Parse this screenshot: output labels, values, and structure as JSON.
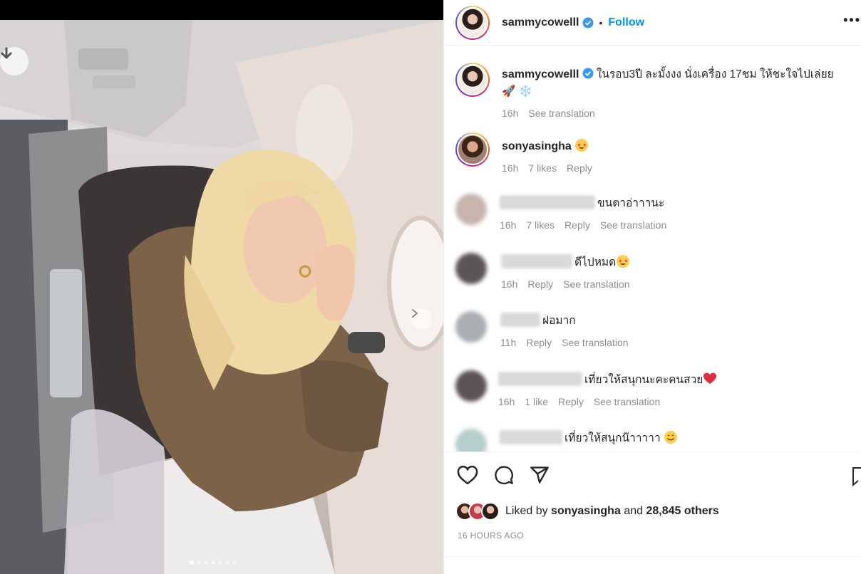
{
  "post": {
    "username": "sammycowelll",
    "follow_label": "Follow",
    "separator": "•",
    "more_label": "•••",
    "caption": "ในรอบ3ปี ละมั้งงง นั่งเครื่อง 17ชม ให้ชะใจไปเล่ยย",
    "caption_time": "16h",
    "see_translation": "See translation",
    "carousel": {
      "slide_count": 7,
      "active_index": 0
    }
  },
  "comments": [
    {
      "username": "sonyasingha",
      "text": "",
      "emoji": "star-struck-emoji",
      "time": "16h",
      "likes": "7 likes",
      "reply": "Reply",
      "translation": ""
    },
    {
      "username": "",
      "text": "ขนตาอ่าาานะ",
      "emoji": "",
      "time": "16h",
      "likes": "7 likes",
      "reply": "Reply",
      "translation": "See translation"
    },
    {
      "username": "",
      "text": "ดีไปหมด",
      "emoji": "star-struck-emoji",
      "time": "16h",
      "likes": "",
      "reply": "Reply",
      "translation": "See translation"
    },
    {
      "username": "",
      "text": "ฝอมาก",
      "emoji": "",
      "time": "11h",
      "likes": "",
      "reply": "Reply",
      "translation": "See translation"
    },
    {
      "username": "",
      "text": "เที่ยวให้สนุกนะคะคนสวย",
      "emoji": "red-heart-emoji",
      "time": "16h",
      "likes": "1 like",
      "reply": "Reply",
      "translation": "See translation"
    },
    {
      "username": "",
      "text": "เที่ยวให้สนุกน๊าาาาา",
      "emoji": "smiling-emoji",
      "time": "",
      "likes": "",
      "reply": "",
      "translation": ""
    }
  ],
  "actions": {
    "liked_prefix": "Liked by",
    "liked_user": "sonyasingha",
    "liked_and": "and",
    "liked_count": "28,845 others",
    "timestamp": "16 HOURS AGO"
  },
  "colors": {
    "accent": "#0095f6",
    "muted": "#8e8e8e",
    "text": "#262626",
    "verified": "#3897f0",
    "divider": "#efefef"
  },
  "icons": [
    "download-icon",
    "next-icon",
    "verified-icon",
    "heart-icon",
    "comment-icon",
    "share-icon",
    "bookmark-icon",
    "rocket-emoji",
    "snowflake-emoji"
  ]
}
